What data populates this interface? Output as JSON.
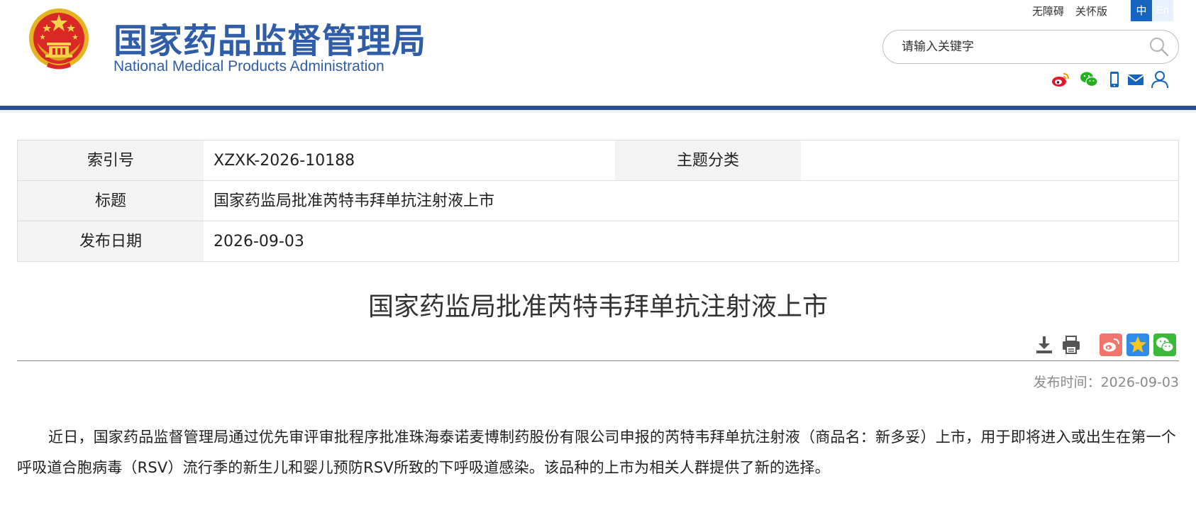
{
  "site": {
    "name_cn": "国家药品监督管理局",
    "name_en": "National Medical Products Administration"
  },
  "top_links": {
    "accessibility": "无障碍",
    "elder_mode": "关怀版",
    "lang_zh": "中",
    "lang_en": "En"
  },
  "search": {
    "placeholder": "请输入关键字"
  },
  "social_icons": [
    "weibo-icon",
    "wechat-icon",
    "mobile-icon",
    "mail-icon",
    "user-icon"
  ],
  "info": {
    "index_label": "索引号",
    "index_value": "XZXK-2026-10188",
    "topic_label": "主题分类",
    "topic_value": "",
    "title_label": "标题",
    "title_value": "国家药监局批准芮特韦拜单抗注射液上市",
    "date_label": "发布日期",
    "date_value": "2026-09-03"
  },
  "article": {
    "title": "国家药监局批准芮特韦拜单抗注射液上市",
    "publish_time": "发布时间：2026-09-03",
    "body": "近日，国家药品监督管理局通过优先审评审批程序批准珠海泰诺麦博制药股份有限公司申报的芮特韦拜单抗注射液（商品名：新多妥）上市，用于即将进入或出生在第一个呼吸道合胞病毒（RSV）流行季的新生儿和婴儿预防RSV所致的下呼吸道感染。该品种的上市为相关人群提供了新的选择。"
  },
  "tools": [
    "download-icon",
    "print-icon",
    "share-weibo-icon",
    "share-qzone-icon",
    "share-wechat-icon"
  ],
  "colors": {
    "brand_blue": "#2f5da8",
    "header_rule": "#2a4f8f",
    "lang_active": "#1565c0",
    "weibo_red": "#e6162d",
    "wechat_green": "#23b11d",
    "share_weibo_bg": "#f0756d",
    "share_qzone_bg": "#2f8ce8",
    "share_wechat_bg": "#3bb93a"
  }
}
